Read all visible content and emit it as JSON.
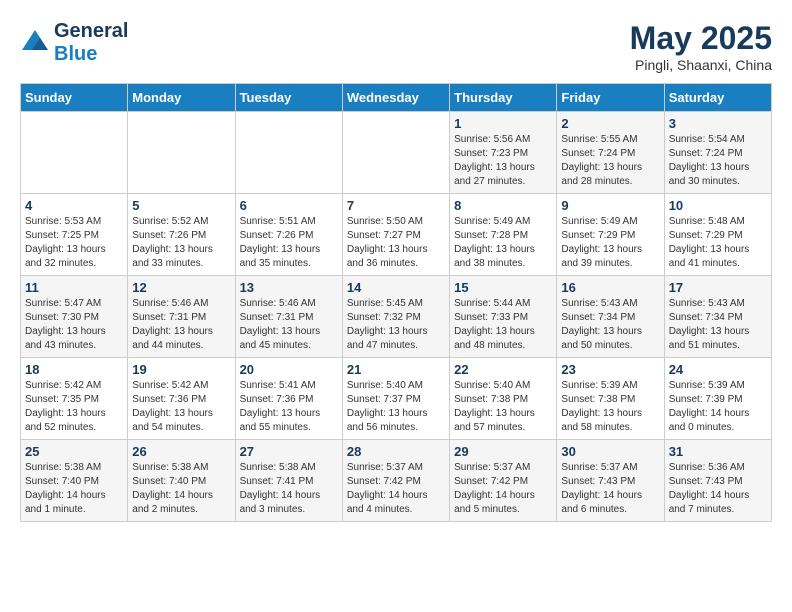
{
  "header": {
    "logo_general": "General",
    "logo_blue": "Blue",
    "month": "May 2025",
    "location": "Pingli, Shaanxi, China"
  },
  "days_of_week": [
    "Sunday",
    "Monday",
    "Tuesday",
    "Wednesday",
    "Thursday",
    "Friday",
    "Saturday"
  ],
  "weeks": [
    [
      {
        "day": "",
        "info": ""
      },
      {
        "day": "",
        "info": ""
      },
      {
        "day": "",
        "info": ""
      },
      {
        "day": "",
        "info": ""
      },
      {
        "day": "1",
        "info": "Sunrise: 5:56 AM\nSunset: 7:23 PM\nDaylight: 13 hours\nand 27 minutes."
      },
      {
        "day": "2",
        "info": "Sunrise: 5:55 AM\nSunset: 7:24 PM\nDaylight: 13 hours\nand 28 minutes."
      },
      {
        "day": "3",
        "info": "Sunrise: 5:54 AM\nSunset: 7:24 PM\nDaylight: 13 hours\nand 30 minutes."
      }
    ],
    [
      {
        "day": "4",
        "info": "Sunrise: 5:53 AM\nSunset: 7:25 PM\nDaylight: 13 hours\nand 32 minutes."
      },
      {
        "day": "5",
        "info": "Sunrise: 5:52 AM\nSunset: 7:26 PM\nDaylight: 13 hours\nand 33 minutes."
      },
      {
        "day": "6",
        "info": "Sunrise: 5:51 AM\nSunset: 7:26 PM\nDaylight: 13 hours\nand 35 minutes."
      },
      {
        "day": "7",
        "info": "Sunrise: 5:50 AM\nSunset: 7:27 PM\nDaylight: 13 hours\nand 36 minutes."
      },
      {
        "day": "8",
        "info": "Sunrise: 5:49 AM\nSunset: 7:28 PM\nDaylight: 13 hours\nand 38 minutes."
      },
      {
        "day": "9",
        "info": "Sunrise: 5:49 AM\nSunset: 7:29 PM\nDaylight: 13 hours\nand 39 minutes."
      },
      {
        "day": "10",
        "info": "Sunrise: 5:48 AM\nSunset: 7:29 PM\nDaylight: 13 hours\nand 41 minutes."
      }
    ],
    [
      {
        "day": "11",
        "info": "Sunrise: 5:47 AM\nSunset: 7:30 PM\nDaylight: 13 hours\nand 43 minutes."
      },
      {
        "day": "12",
        "info": "Sunrise: 5:46 AM\nSunset: 7:31 PM\nDaylight: 13 hours\nand 44 minutes."
      },
      {
        "day": "13",
        "info": "Sunrise: 5:46 AM\nSunset: 7:31 PM\nDaylight: 13 hours\nand 45 minutes."
      },
      {
        "day": "14",
        "info": "Sunrise: 5:45 AM\nSunset: 7:32 PM\nDaylight: 13 hours\nand 47 minutes."
      },
      {
        "day": "15",
        "info": "Sunrise: 5:44 AM\nSunset: 7:33 PM\nDaylight: 13 hours\nand 48 minutes."
      },
      {
        "day": "16",
        "info": "Sunrise: 5:43 AM\nSunset: 7:34 PM\nDaylight: 13 hours\nand 50 minutes."
      },
      {
        "day": "17",
        "info": "Sunrise: 5:43 AM\nSunset: 7:34 PM\nDaylight: 13 hours\nand 51 minutes."
      }
    ],
    [
      {
        "day": "18",
        "info": "Sunrise: 5:42 AM\nSunset: 7:35 PM\nDaylight: 13 hours\nand 52 minutes."
      },
      {
        "day": "19",
        "info": "Sunrise: 5:42 AM\nSunset: 7:36 PM\nDaylight: 13 hours\nand 54 minutes."
      },
      {
        "day": "20",
        "info": "Sunrise: 5:41 AM\nSunset: 7:36 PM\nDaylight: 13 hours\nand 55 minutes."
      },
      {
        "day": "21",
        "info": "Sunrise: 5:40 AM\nSunset: 7:37 PM\nDaylight: 13 hours\nand 56 minutes."
      },
      {
        "day": "22",
        "info": "Sunrise: 5:40 AM\nSunset: 7:38 PM\nDaylight: 13 hours\nand 57 minutes."
      },
      {
        "day": "23",
        "info": "Sunrise: 5:39 AM\nSunset: 7:38 PM\nDaylight: 13 hours\nand 58 minutes."
      },
      {
        "day": "24",
        "info": "Sunrise: 5:39 AM\nSunset: 7:39 PM\nDaylight: 14 hours\nand 0 minutes."
      }
    ],
    [
      {
        "day": "25",
        "info": "Sunrise: 5:38 AM\nSunset: 7:40 PM\nDaylight: 14 hours\nand 1 minute."
      },
      {
        "day": "26",
        "info": "Sunrise: 5:38 AM\nSunset: 7:40 PM\nDaylight: 14 hours\nand 2 minutes."
      },
      {
        "day": "27",
        "info": "Sunrise: 5:38 AM\nSunset: 7:41 PM\nDaylight: 14 hours\nand 3 minutes."
      },
      {
        "day": "28",
        "info": "Sunrise: 5:37 AM\nSunset: 7:42 PM\nDaylight: 14 hours\nand 4 minutes."
      },
      {
        "day": "29",
        "info": "Sunrise: 5:37 AM\nSunset: 7:42 PM\nDaylight: 14 hours\nand 5 minutes."
      },
      {
        "day": "30",
        "info": "Sunrise: 5:37 AM\nSunset: 7:43 PM\nDaylight: 14 hours\nand 6 minutes."
      },
      {
        "day": "31",
        "info": "Sunrise: 5:36 AM\nSunset: 7:43 PM\nDaylight: 14 hours\nand 7 minutes."
      }
    ]
  ]
}
